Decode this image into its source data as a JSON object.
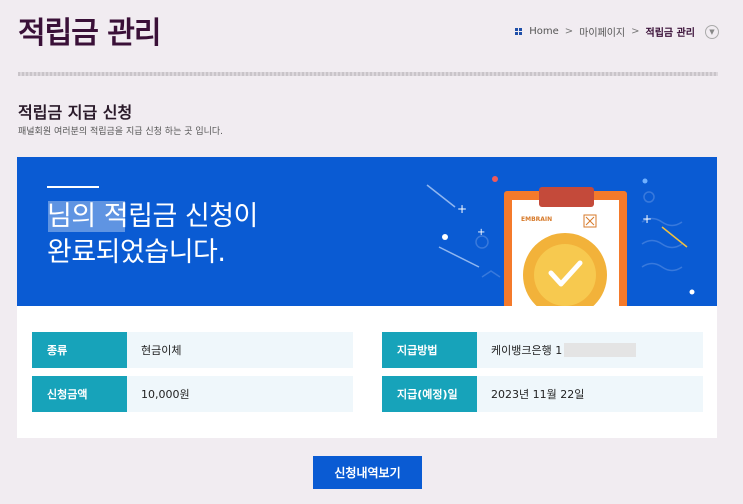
{
  "page": {
    "title": "적립금 관리"
  },
  "breadcrumb": {
    "home": "Home",
    "sep1": ">",
    "level1": "마이페이지",
    "sep2": ">",
    "current": "적립금 관리"
  },
  "section": {
    "title": "적립금 지급 신청",
    "description": "패널회원 여러분의 적립금을 지급 신청 하는 곳 입니다."
  },
  "banner": {
    "message": "님의 적립금 신청이\n완료되었습니다.",
    "clipboard_brand": "EMBRAIN",
    "background_color": "#0a5bd3"
  },
  "details": {
    "type_label": "종류",
    "type_value": "현금이체",
    "method_label": "지급방법",
    "method_value": "케이뱅크은행 1",
    "amount_label": "신청금액",
    "amount_value": "10,000원",
    "date_label": "지급(예정)일",
    "date_value": "2023년 11월 22일",
    "label_color": "#17a3ba"
  },
  "actions": {
    "history_label": "신청내역보기"
  }
}
